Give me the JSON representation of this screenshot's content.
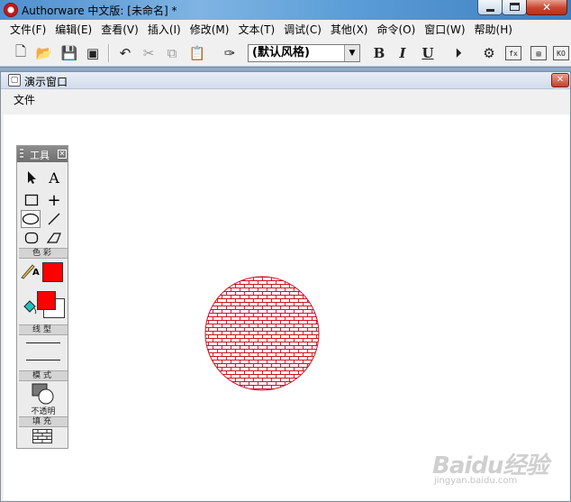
{
  "window": {
    "title": "Authorware 中文版: [未命名] *",
    "min_glyph": "",
    "close_glyph": "✕"
  },
  "menubar": {
    "items": [
      "文件(F)",
      "编辑(E)",
      "查看(V)",
      "插入(I)",
      "修改(M)",
      "文本(T)",
      "调试(C)",
      "其他(X)",
      "命令(O)",
      "窗口(W)",
      "帮助(H)"
    ]
  },
  "toolbar": {
    "style_select": {
      "value": "(默认风格)",
      "arrow": "▼"
    },
    "bold": "B",
    "italic": "I",
    "underline": "U",
    "icons": {
      "new": "🗋",
      "open": "📂",
      "save_all": "💾",
      "import": "▣",
      "undo": "↶",
      "cut": "✂",
      "copy": "⧉",
      "paste": "📋",
      "find": "✑",
      "run": "⏵",
      "control_panel": "⚙",
      "functions": "fx",
      "variables": "▤",
      "knowledge_objects": "KO"
    }
  },
  "presentation_window": {
    "title": "演示窗口",
    "close_glyph": "✕",
    "menu": [
      "文件"
    ]
  },
  "tools_palette": {
    "title": "工具",
    "close_glyph": "✕",
    "sections": {
      "color": "色彩",
      "line_style": "线型",
      "mode": "模式",
      "fill": "填充"
    },
    "mode_caption": "不透明",
    "text_tool_glyph": "A",
    "pen_color_glyph": "A",
    "crosshair_glyph": "+",
    "colors": {
      "line_color": "#ff0000",
      "fill_foreground": "#ff0000",
      "fill_background": "#ffffff"
    }
  },
  "stage": {
    "shape": "ellipse",
    "fill_pattern": "brick",
    "stroke_color": "#cc1020",
    "pattern_color": "#cc1020",
    "background": "#ffffff"
  },
  "watermark": {
    "text": "Baidu经验",
    "url": "jingyan.baidu.com"
  }
}
